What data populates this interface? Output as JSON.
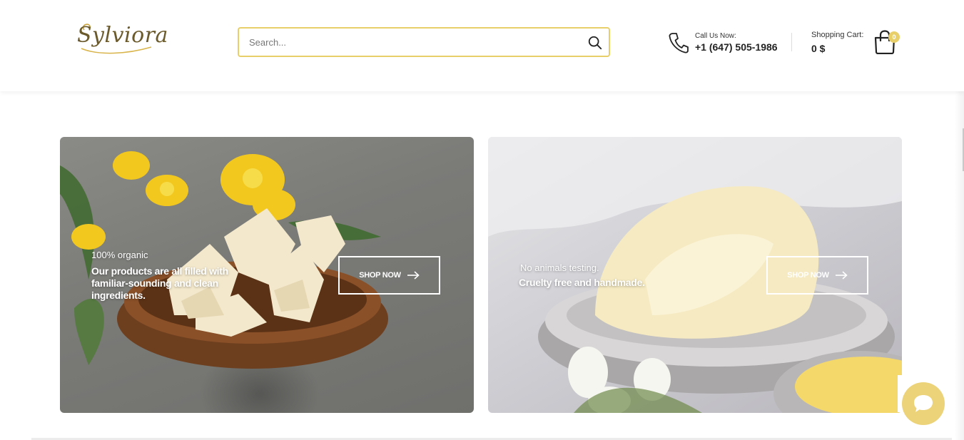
{
  "header": {
    "logo_text": "Sylviora",
    "search": {
      "placeholder": "Search...",
      "value": ""
    },
    "contact": {
      "label": "Call Us Now:",
      "phone": "+1 (647) 505-1986"
    },
    "cart": {
      "label": "Shopping Cart:",
      "total": "0 $",
      "count": "0"
    }
  },
  "banners": [
    {
      "subtitle": "100% organic",
      "headline": "Our products are all filled with familiar-sounding and clean ingredients.",
      "button_label": "SHOP NOW"
    },
    {
      "subtitle": "No animals testing.",
      "headline": "Cruelty free and handmade.",
      "button_label": "SHOP NOW"
    }
  ],
  "colors": {
    "accent": "#e8cf6a",
    "chat_button": "#ecd37a",
    "text_dark": "#222222"
  },
  "icons": {
    "search": "search-icon",
    "phone": "phone-icon",
    "cart": "shopping-bag-icon",
    "arrow": "arrow-right-icon",
    "chat": "chat-bubble-icon"
  }
}
